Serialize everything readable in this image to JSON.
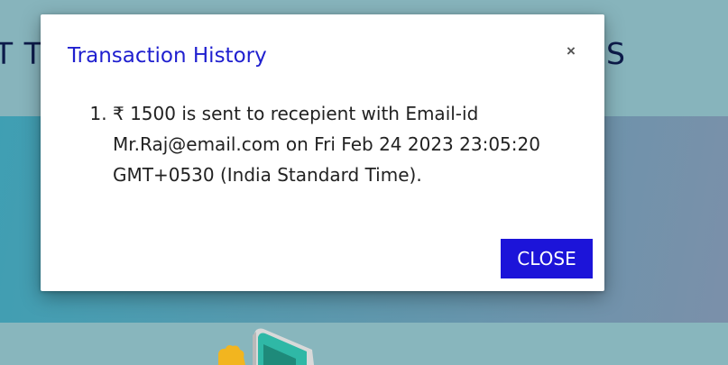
{
  "page": {
    "header_left_fragment": "T T",
    "header_right_fragment": "S"
  },
  "modal": {
    "title": "Transaction History",
    "close_icon": "×",
    "close_button_label": "CLOSE",
    "transactions": [
      "₹ 1500 is sent to recepient with Email-id Mr.Raj@email.com on Fri Feb 24 2023 23:05:20 GMT+0530 (India Standard Time)."
    ]
  },
  "colors": {
    "title_accent": "#1f1fcf",
    "close_button_bg": "#1c14d9",
    "hero_gradient_start": "#3f9fb3",
    "hero_gradient_end": "#7b90aa",
    "page_bg": "#87b4bc"
  },
  "icons": {
    "modal_close": "close-icon",
    "illustration": "payment-illustration"
  }
}
